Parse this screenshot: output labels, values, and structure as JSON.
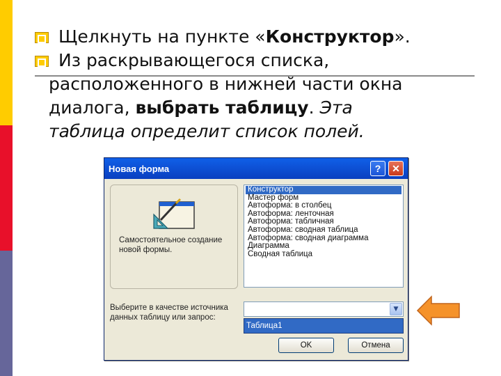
{
  "slide": {
    "bullet1": {
      "prefix": "Щелкнуть на пункте «",
      "bold": "Конструктор",
      "suffix": "»."
    },
    "bullet2": {
      "line1": "Из раскрывающегося списка,",
      "line2": "расположенного в нижней части окна",
      "line3_prefix": "диалога, ",
      "line3_bold": "выбрать таблицу",
      "line3_dot": ".",
      "line3_italic": " Эта",
      "line4_italic": "таблица определит список полей."
    }
  },
  "dialog": {
    "title": "Новая форма",
    "help_label": "?",
    "close_label": "✕",
    "description": "Самостоятельное создание новой формы.",
    "list_items": [
      "Конструктор",
      "Мастер форм",
      "Автоформа: в столбец",
      "Автоформа: ленточная",
      "Автоформа: табличная",
      "Автоформа:  сводная таблица",
      "Автоформа:  сводная диаграмма",
      "Диаграмма",
      "Сводная таблица"
    ],
    "selected_index": 0,
    "prompt": "Выберите в качестве источника данных таблицу или запрос:",
    "combo_value": "",
    "dropdown_option": "Таблица1",
    "ok_label": "OK",
    "cancel_label": "Отмена"
  },
  "colors": {
    "bar_yellow": "#ffcc00",
    "bar_red": "#e8102a",
    "bar_purple": "#66669a",
    "arrow_orange": "#f5922a",
    "title_blue": "#0a3fc0",
    "selection_blue": "#316ac5"
  },
  "icons": [
    "bullet-icon",
    "form-design-icon",
    "help-icon",
    "close-icon",
    "dropdown-chevron-icon",
    "orange-arrow-icon"
  ]
}
